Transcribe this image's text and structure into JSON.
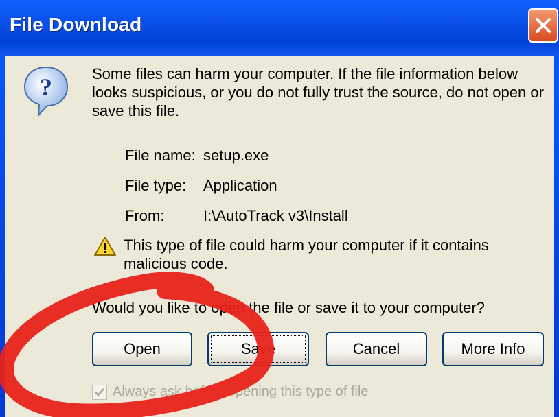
{
  "dialog": {
    "title": "File Download",
    "close_label": "×",
    "message": "Some files can harm your computer. If the file information below looks suspicious, or you do not fully trust the source, do not open or save this file.",
    "file_info": [
      {
        "label": "File name:",
        "value": "setup.exe"
      },
      {
        "label": "File type:",
        "value": "Application"
      },
      {
        "label": "From:",
        "value": "I:\\AutoTrack v3\\Install"
      }
    ],
    "warning": "This type of file could harm your computer if it contains malicious code.",
    "question": "Would you like to open the file or save it to your computer?",
    "buttons": {
      "open": "Open",
      "save": "Save",
      "cancel": "Cancel",
      "more_info": "More Info"
    },
    "checkbox_label": "Always ask before opening this type of file"
  }
}
